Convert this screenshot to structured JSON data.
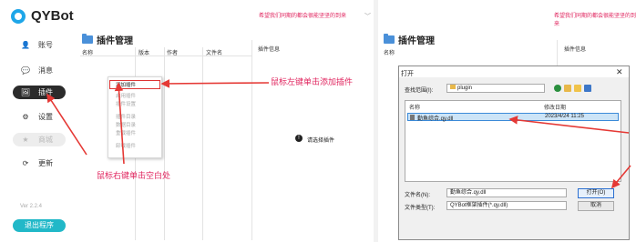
{
  "left": {
    "brand": "QYBot",
    "notice": "希望我们同期的都会很能坚坚的到来",
    "nav": [
      {
        "icon": "user-icon",
        "glyph": "👤",
        "label": "账号"
      },
      {
        "icon": "chat-icon",
        "glyph": "💬",
        "label": "消息"
      },
      {
        "icon": "plugin-icon",
        "glyph": "🖼",
        "label": "插件"
      },
      {
        "icon": "gear-icon",
        "glyph": "⚙",
        "label": "设置"
      },
      {
        "icon": "star-icon",
        "glyph": "★",
        "label": "商城"
      },
      {
        "icon": "refresh-icon",
        "glyph": "⟳",
        "label": "更新"
      }
    ],
    "version": "Ver 2.2.4",
    "exit_label": "退出程序",
    "page_title": "插件管理",
    "columns": [
      "名称",
      "版本",
      "作者",
      "文件名"
    ],
    "info_header": "插件信息",
    "select_prompt": "请选择插件",
    "context_menu": [
      "添加插件",
      "启用插件",
      "插件设置",
      "插件目录",
      "数据目录",
      "重载插件",
      "卸载插件"
    ],
    "annotation_left_click": "鼠标左键单击添加插件",
    "annotation_right_click": "鼠标右键单击空白处"
  },
  "right": {
    "notice": "希望我们同期的都会很能坚坚的到来",
    "page_title": "插件管理",
    "col_name": "名称",
    "info_header": "插件信息",
    "dialog": {
      "title": "打开",
      "lookin_label": "查找范围(I):",
      "lookin_value": "plugin",
      "col_name": "名称",
      "col_modified": "修改日期",
      "file_name": "勤鱼综合.qy.dll",
      "file_date": "2023/4/24 11:25",
      "filename_label": "文件名(N):",
      "filename_value": "勤鱼综合.qy.dll",
      "filetype_label": "文件类型(T):",
      "filetype_value": "QYBot框架插件(*.qy.dll)",
      "open_label": "打开(O)",
      "cancel_label": "取消"
    }
  },
  "colors": {
    "accent": "#21b8c8",
    "annotation": "#e0245e",
    "arrow": "#e53935"
  }
}
